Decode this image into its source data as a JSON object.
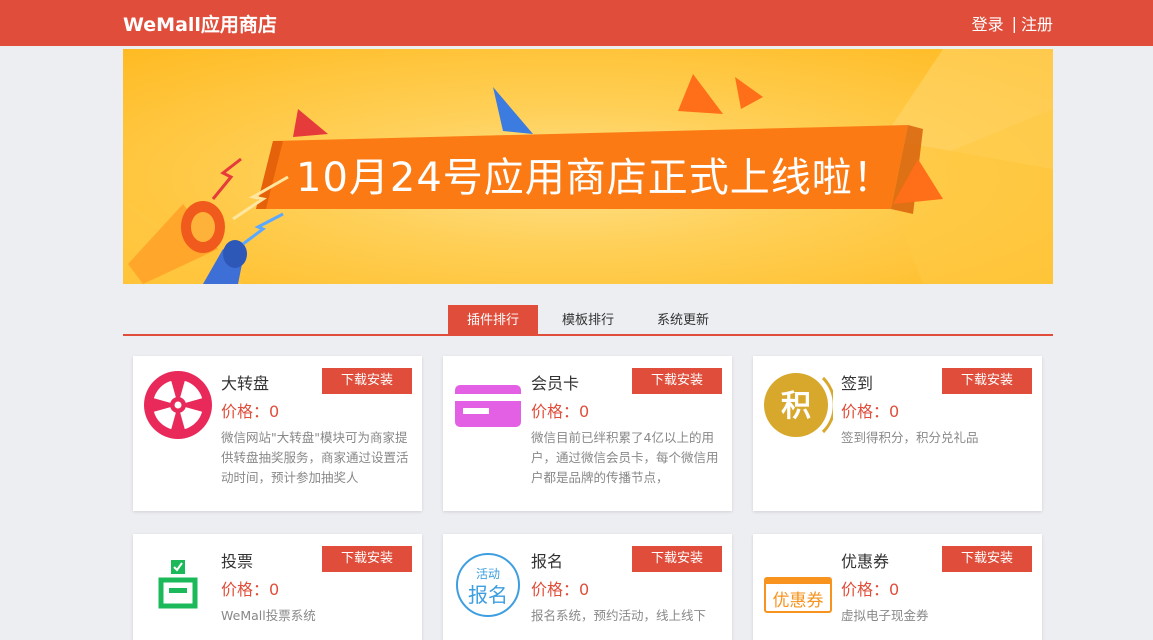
{
  "header": {
    "brand": "WeMall应用商店",
    "login": "登录",
    "separator": "|",
    "register": "注册"
  },
  "banner": {
    "headline": "10月24号应用商店正式上线啦！"
  },
  "tabs": [
    {
      "label": "插件排行",
      "active": true
    },
    {
      "label": "模板排行",
      "active": false
    },
    {
      "label": "系统更新",
      "active": false
    }
  ],
  "cards": [
    {
      "icon": "wheel-icon",
      "title": "大转盘",
      "button": "下载安装",
      "price": "价格：0",
      "desc": "微信网站\"大转盘\"模块可为商家提供转盘抽奖服务，商家通过设置活动时间，预计参加抽奖人"
    },
    {
      "icon": "member-card-icon",
      "title": "会员卡",
      "button": "下载安装",
      "price": "价格：0",
      "desc": "微信目前已绊积累了4亿以上的用户，通过微信会员卡，每个微信用户都是品牌的传播节点，"
    },
    {
      "icon": "points-icon",
      "icon_text": "积",
      "title": "签到",
      "button": "下载安装",
      "price": "价格：0",
      "desc": "签到得积分，积分兑礼品"
    },
    {
      "icon": "ballot-box-icon",
      "title": "投票",
      "button": "下载安装",
      "price": "价格：0",
      "desc": "WeMall投票系统"
    },
    {
      "icon": "signup-stamp-icon",
      "icon_text_top": "活动",
      "icon_text_bottom": "报名",
      "title": "报名",
      "button": "下载安装",
      "price": "价格：0",
      "desc": "报名系统，预约活动，线上线下"
    },
    {
      "icon": "coupon-icon",
      "icon_text": "优惠券",
      "title": "优惠券",
      "button": "下载安装",
      "price": "价格：0",
      "desc": "虚拟电子现金券"
    }
  ],
  "colors": {
    "accent": "#e04e3b",
    "background": "#edeef2",
    "banner": "#ffc233"
  }
}
